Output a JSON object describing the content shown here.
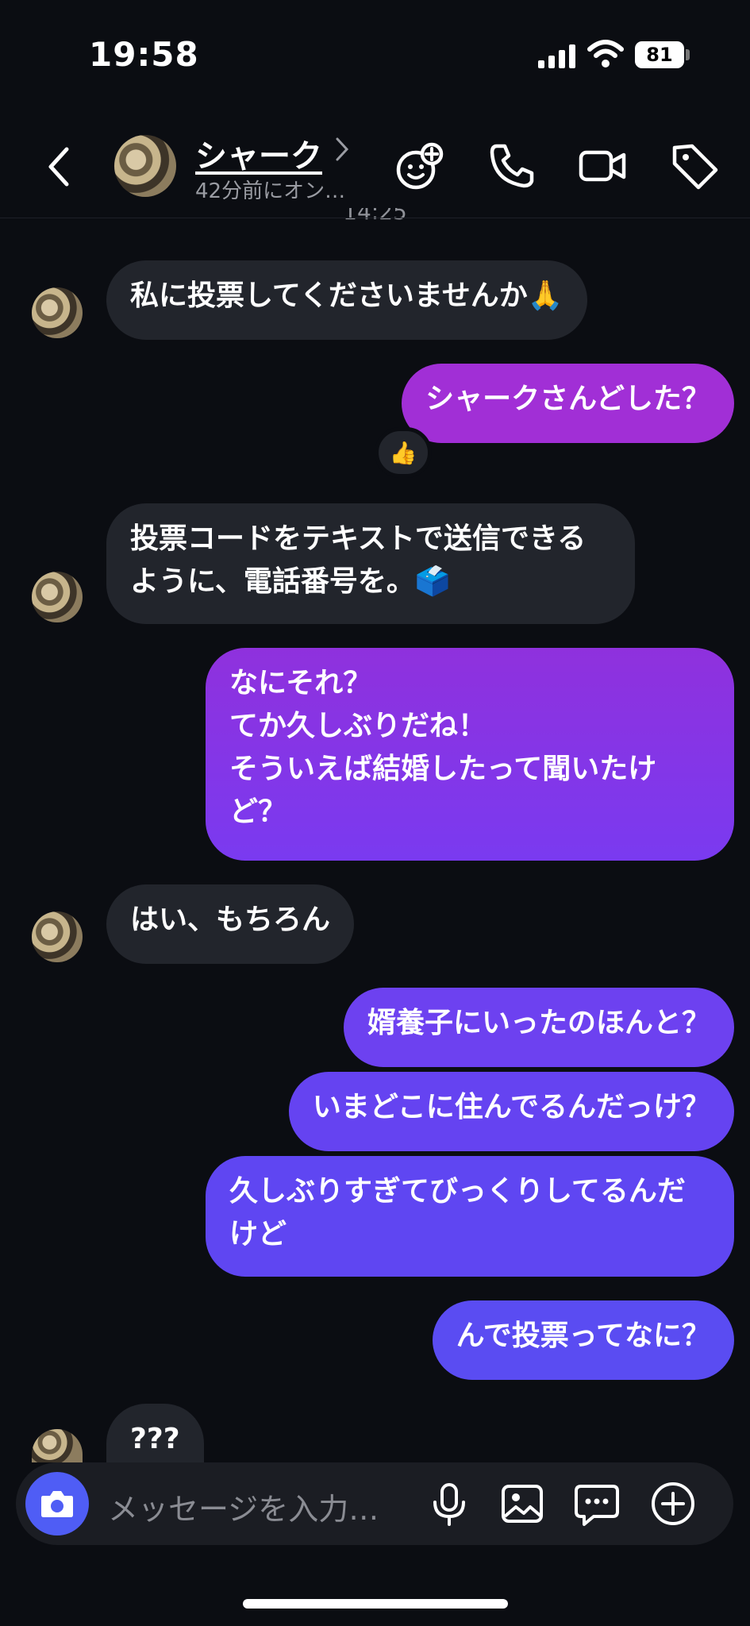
{
  "status_bar": {
    "time": "19:58",
    "battery": "81"
  },
  "header": {
    "contact_name": "シャーク",
    "contact_status": "42分前にオン…",
    "timestamp": "14:25"
  },
  "messages": [
    {
      "side": "in",
      "text": "私に投票してくださいませんか🙏"
    },
    {
      "side": "out",
      "text": "シャークさんどした？",
      "reaction": "👍"
    },
    {
      "side": "in",
      "text": "投票コードをテキストで送信できるように、電話番号を。🗳️"
    },
    {
      "side": "out",
      "text": "なにそれ？\nてか久しぶりだね！\nそういえば結婚したって聞いたけど？"
    },
    {
      "side": "in",
      "text": "はい、もちろん"
    },
    {
      "side": "out",
      "text": "婿養子にいったのほんと？"
    },
    {
      "side": "out",
      "text": "いまどこに住んでるんだっけ？"
    },
    {
      "side": "out",
      "text": "久しぶりすぎてびっくりしてるんだけど"
    },
    {
      "side": "out",
      "text": "んで投票ってなに？"
    },
    {
      "side": "in",
      "text": "???"
    }
  ],
  "composer": {
    "placeholder": "メッセージを入力…"
  },
  "icons": {
    "back": "chevron-left-icon",
    "effects": "face-sparkle-icon",
    "call": "phone-icon",
    "video": "video-camera-icon",
    "tag": "tag-icon",
    "camera": "camera-icon",
    "mic": "microphone-icon",
    "gallery": "image-icon",
    "sticker": "chat-bubble-icon",
    "add": "plus-circle-icon"
  },
  "colors": {
    "background": "#0b0d12",
    "incoming_bubble": "#22252c",
    "outgoing_gradient_top": "#a12fd6",
    "outgoing_gradient_bottom": "#5a4cf2",
    "accent": "#4f5df5"
  }
}
